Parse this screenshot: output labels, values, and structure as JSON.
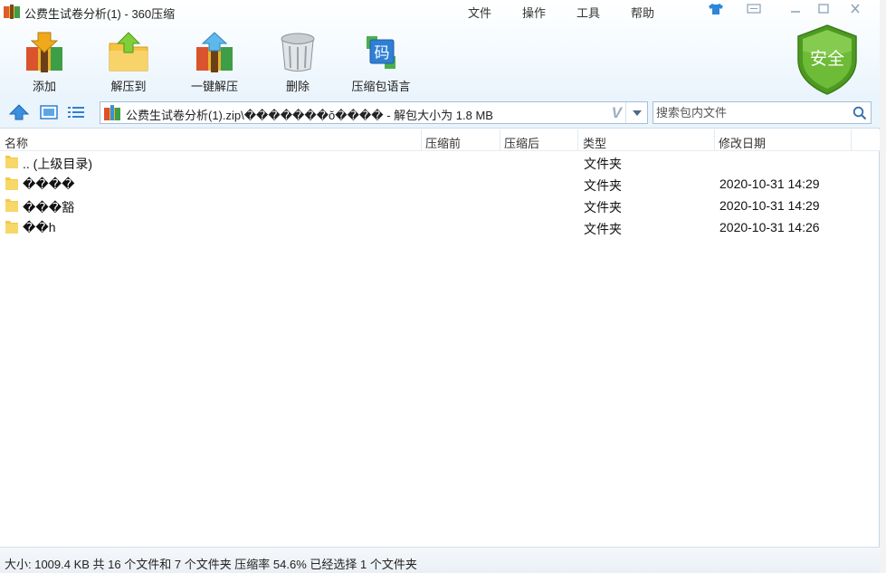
{
  "window": {
    "title": "公费生试卷分析(1) - 360压缩",
    "menu": [
      "文件",
      "操作",
      "工具",
      "帮助"
    ],
    "controls": [
      "skin-icon",
      "feedback-icon",
      "minimize-icon",
      "maximize-icon",
      "close-icon"
    ]
  },
  "toolbar": {
    "buttons": [
      {
        "label": "添加",
        "icon": "add-archive-icon"
      },
      {
        "label": "解压到",
        "icon": "extract-to-icon"
      },
      {
        "label": "一键解压",
        "icon": "one-click-extract-icon"
      },
      {
        "label": "删除",
        "icon": "delete-trash-icon"
      },
      {
        "label": "压缩包语言",
        "icon": "archive-language-icon"
      }
    ],
    "security_label": "安全"
  },
  "addressbar": {
    "path": "公费生试卷分析(1).zip\\�������ŏ���� - 解包大小为 1.8 MB",
    "search_placeholder": "搜索包内文件"
  },
  "columns": [
    "名称",
    "压缩前",
    "压缩后",
    "类型",
    "修改日期"
  ],
  "rows": [
    {
      "name": ".. (上级目录)",
      "type": "文件夹",
      "date": ""
    },
    {
      "name": "����",
      "type": "文件夹",
      "date": "2020-10-31 14:29"
    },
    {
      "name": "���豁",
      "type": "文件夹",
      "date": "2020-10-31 14:29"
    },
    {
      "name": "��h",
      "type": "文件夹",
      "date": "2020-10-31 14:26"
    }
  ],
  "status": "大小: 1009.4 KB 共 16 个文件和 7 个文件夹 压缩率 54.6% 已经选择 1 个文件夹",
  "colors": {
    "toolbar_bg": "#eaf4fc",
    "shield_green": "#5fae2e",
    "folder_yellow": "#f2c94c"
  }
}
